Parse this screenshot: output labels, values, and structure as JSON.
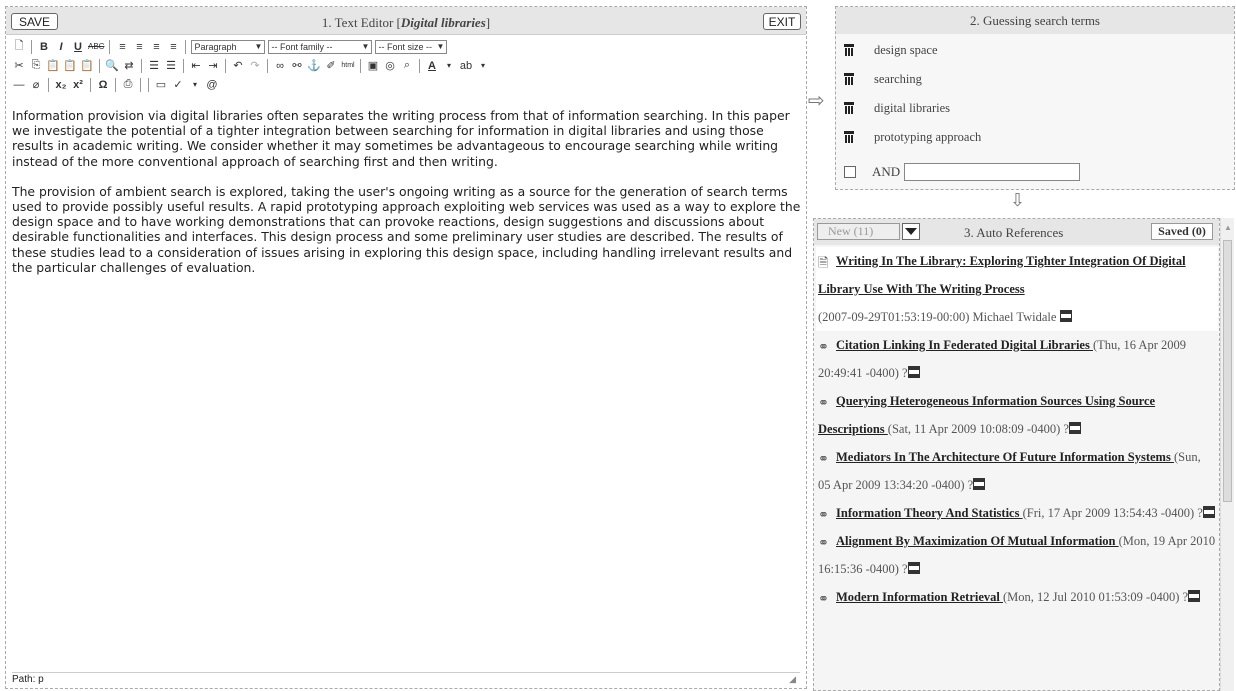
{
  "editor": {
    "save_label": "SAVE",
    "exit_label": "EXIT",
    "title_prefix": "1. Text Editor [",
    "title_doc": "Digital libraries",
    "title_suffix": "]",
    "toolbar": {
      "block_format": "Paragraph",
      "font_family": "-- Font family --",
      "font_size": "-- Font size --"
    },
    "paragraphs": [
      "Information provision via digital libraries often separates the writing process from that of information searching. In this paper we investigate the potential of a tighter integration between searching for information in digital libraries and using those results in academic writing. We consider whether it may sometimes be advantageous to encourage searching while writing instead of the more conventional approach of searching first and then writing.",
      "The provision of ambient search is explored, taking the user's ongoing writing as a source for the generation of search terms used to provide possibly useful results. A rapid prototyping approach exploiting web services was used as a way to explore the design space and to have working demonstrations that can provoke reactions, design suggestions and discussions about desirable functionalities and interfaces. This design process and some preliminary user studies are described. The results of these studies lead to a consideration of issues arising in exploring this design space, including handling irrelevant results and the particular challenges of evaluation."
    ],
    "status_path": "Path: p"
  },
  "terms_panel": {
    "title": "2. Guessing search terms",
    "terms": [
      "design space",
      "searching",
      "digital libraries",
      "prototyping approach"
    ],
    "and_label": "AND",
    "and_value": ""
  },
  "refs_panel": {
    "new_label": "New (11)",
    "title": "3. Auto References",
    "saved_label": "Saved (0)",
    "refs": [
      {
        "title": "Writing In The Library: Exploring Tighter Integration Of Digital Library Use With The Writing Process",
        "meta": "(2007-09-29T01:53:19-00:00) Michael Twidale"
      },
      {
        "title": "Citation Linking In Federated Digital Libraries ",
        "meta": "(Thu, 16 Apr 2009 20:49:41 -0400) ?"
      },
      {
        "title": "Querying Heterogeneous Information Sources Using Source Descriptions ",
        "meta": "(Sat, 11 Apr 2009 10:08:09 -0400) ?"
      },
      {
        "title": "Mediators In The Architecture Of Future Information Systems ",
        "meta": "(Sun, 05 Apr 2009 13:34:20 -0400) ?"
      },
      {
        "title": "Information Theory And Statistics ",
        "meta": "(Fri, 17 Apr 2009 13:54:43 -0400) ?"
      },
      {
        "title": "Alignment By Maximization Of Mutual Information ",
        "meta": "(Mon, 19 Apr 2010 16:15:36 -0400) ?"
      },
      {
        "title": "Modern Information Retrieval ",
        "meta": "(Mon, 12 Jul 2010 01:53:09 -0400) ?"
      }
    ]
  }
}
